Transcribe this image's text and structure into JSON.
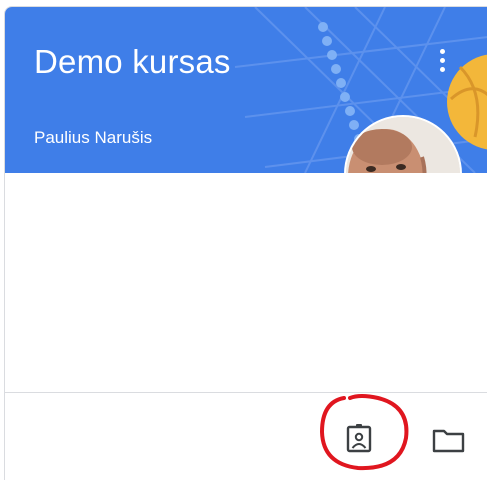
{
  "course_card": {
    "title": "Demo kursas",
    "teacher": "Paulius Narušis",
    "header_color": "#3f7ee8",
    "menu_icon": "more-vert-icon",
    "footer": {
      "gradebook_icon": "assignment-ind-icon",
      "folder_icon": "folder-icon"
    },
    "annotation_color": "#e0161f"
  }
}
